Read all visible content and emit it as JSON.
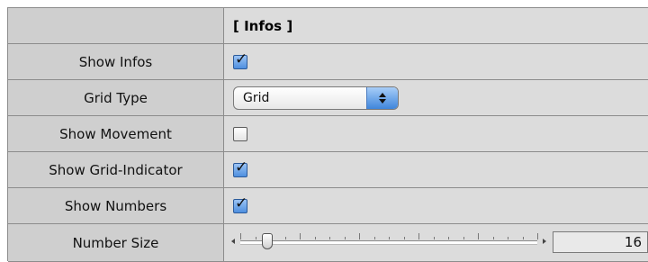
{
  "header": {
    "title": "[ Infos ]"
  },
  "rows": [
    {
      "label": "Show Infos",
      "type": "checkbox",
      "checked": true
    },
    {
      "label": "Grid Type",
      "type": "select",
      "value": "Grid"
    },
    {
      "label": "Show Movement",
      "type": "checkbox",
      "checked": false
    },
    {
      "label": "Show Grid-Indicator",
      "type": "checkbox",
      "checked": true
    },
    {
      "label": "Show Numbers",
      "type": "checkbox",
      "checked": true
    },
    {
      "label": "Number Size",
      "type": "slider",
      "value": "16",
      "slider_fraction": 0.09
    }
  ],
  "check_glyph": "✓",
  "icons": {
    "checkbox_check": "check-icon",
    "select_arrows": "up-down-arrows-icon",
    "slider_left": "arrow-left-icon",
    "slider_right": "arrow-right-icon"
  }
}
